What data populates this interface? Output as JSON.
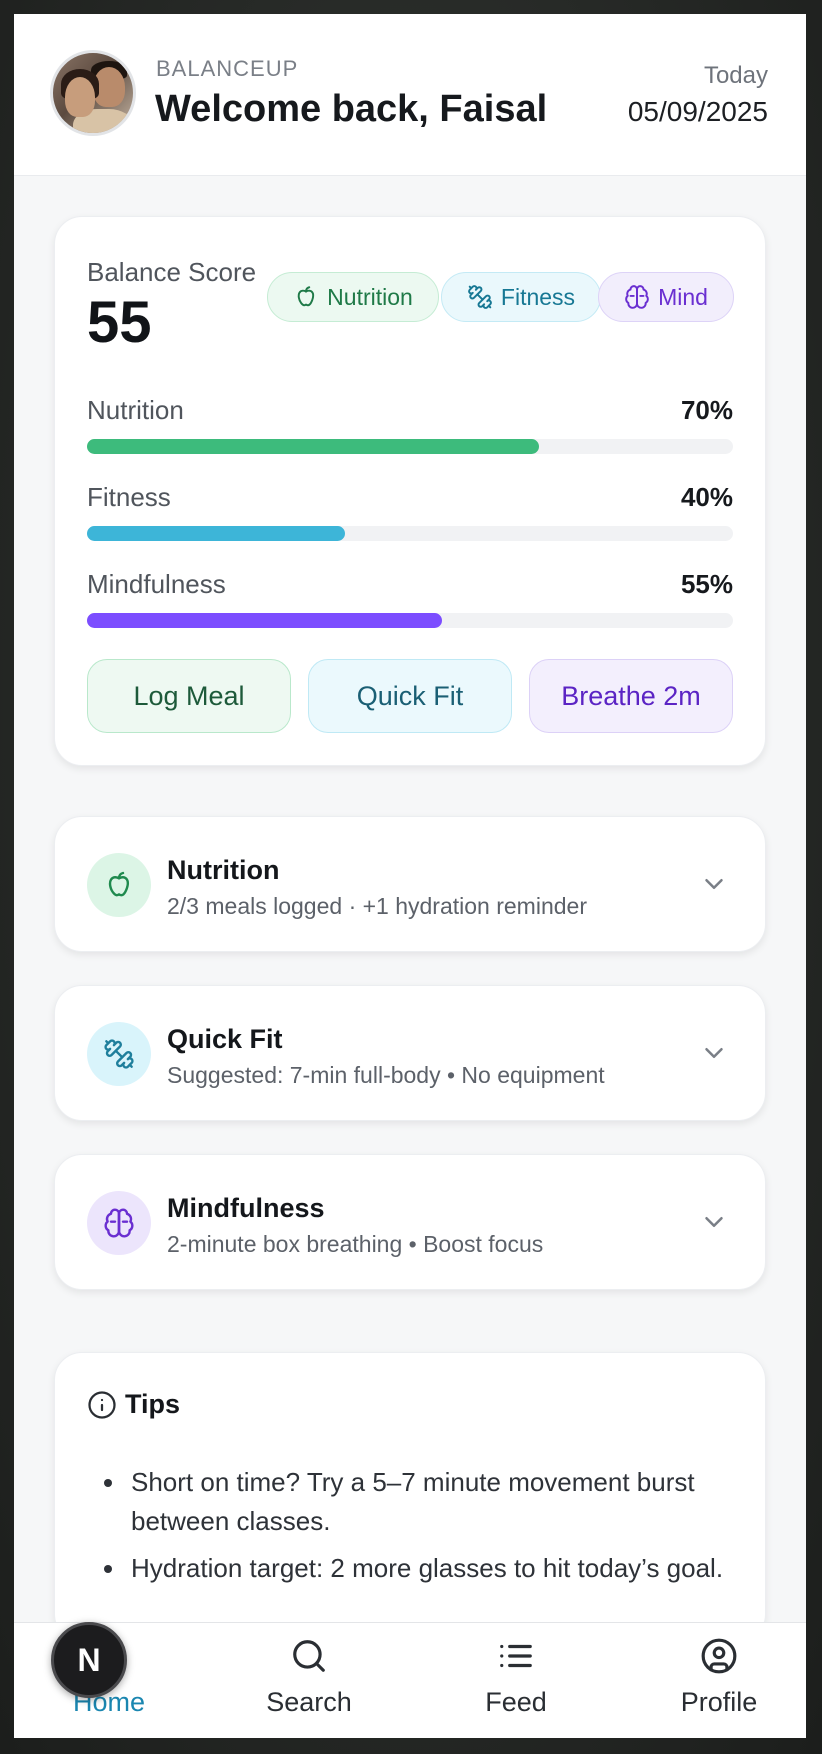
{
  "header": {
    "brand": "BALANCEUP",
    "welcome": "Welcome back, Faisal",
    "today_label": "Today",
    "date": "05/09/2025"
  },
  "score_card": {
    "label": "Balance Score",
    "value": "55",
    "chips": [
      {
        "label": "Nutrition",
        "icon": "apple-icon"
      },
      {
        "label": "Fitness",
        "icon": "dumbbell-icon"
      },
      {
        "label": "Mind",
        "icon": "brain-icon"
      }
    ],
    "metrics": [
      {
        "label": "Nutrition",
        "pct_text": "70%",
        "value": 0.7,
        "color": "#3dbb7c"
      },
      {
        "label": "Fitness",
        "pct_text": "40%",
        "value": 0.4,
        "color": "#3db5d8"
      },
      {
        "label": "Mindfulness",
        "pct_text": "55%",
        "value": 0.55,
        "color": "#7c4dff"
      }
    ],
    "actions": [
      "Log Meal",
      "Quick Fit",
      "Breathe 2m"
    ]
  },
  "sections": [
    {
      "title": "Nutrition",
      "subtitle": "2/3 meals logged · +1 hydration reminder",
      "icon": "apple-icon"
    },
    {
      "title": "Quick Fit",
      "subtitle": "Suggested: 7-min full-body • No equipment",
      "icon": "dumbbell-icon"
    },
    {
      "title": "Mindfulness",
      "subtitle": "2-minute box breathing • Boost focus",
      "icon": "brain-icon"
    }
  ],
  "tips": {
    "title": "Tips",
    "items": [
      "Short on time? Try a 5–7 minute movement burst between classes.",
      "Hydration target: 2 more glasses to hit today’s goal."
    ]
  },
  "nav": {
    "items": [
      {
        "label": "Home",
        "icon": "home-icon",
        "active": true
      },
      {
        "label": "Search",
        "icon": "search-icon"
      },
      {
        "label": "Feed",
        "icon": "list-icon"
      },
      {
        "label": "Profile",
        "icon": "user-circle-icon"
      }
    ],
    "badge_letter": "N"
  },
  "colors": {
    "nutrition": "#3dbb7c",
    "fitness": "#3db5d8",
    "mind": "#7c4dff",
    "active_nav": "#1a86b0"
  }
}
